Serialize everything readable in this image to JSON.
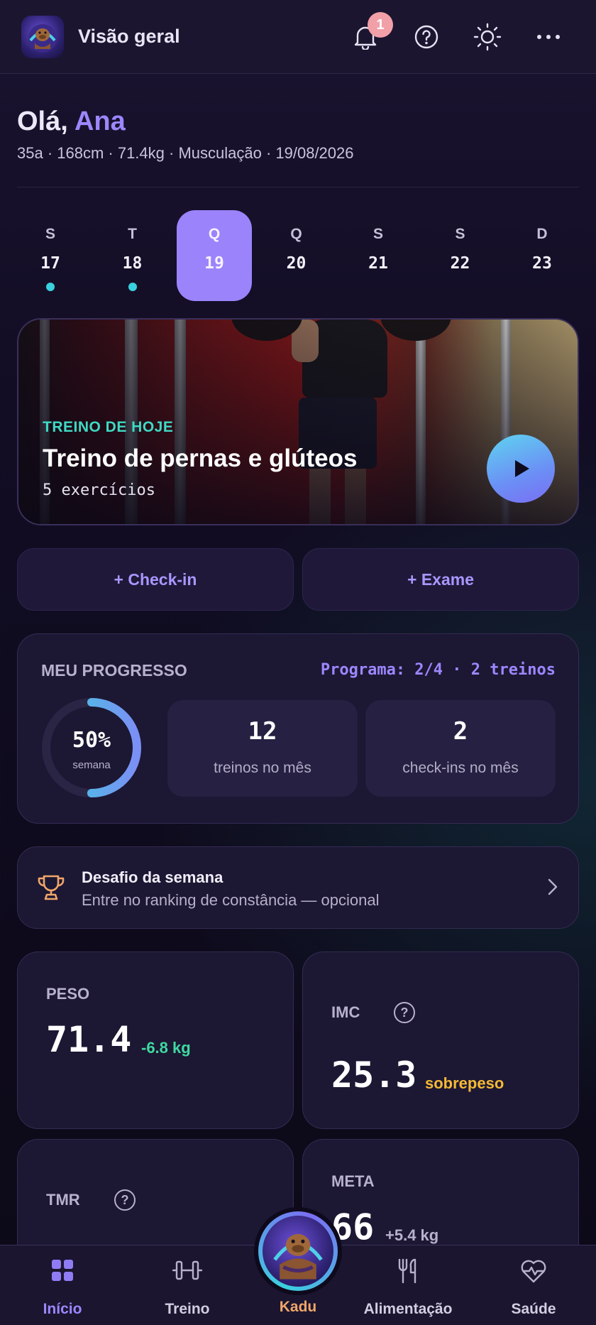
{
  "header": {
    "title": "Visão geral",
    "notification_count": "1",
    "icons": [
      "mascot-logo",
      "bell-icon",
      "help-icon",
      "theme-sun-icon",
      "more-icon"
    ]
  },
  "greeting": {
    "hello": "Olá,",
    "name": "Ana",
    "meta": "35a · 168cm · 71.4kg · Musculação · 19/08/2026"
  },
  "week": [
    {
      "letter": "S",
      "num": "17",
      "dot": true,
      "active": false
    },
    {
      "letter": "T",
      "num": "18",
      "dot": true,
      "active": false
    },
    {
      "letter": "Q",
      "num": "19",
      "dot": false,
      "active": true
    },
    {
      "letter": "Q",
      "num": "20",
      "dot": false,
      "active": false
    },
    {
      "letter": "S",
      "num": "21",
      "dot": false,
      "active": false
    },
    {
      "letter": "S",
      "num": "22",
      "dot": false,
      "active": false
    },
    {
      "letter": "D",
      "num": "23",
      "dot": false,
      "active": false
    }
  ],
  "today": {
    "tag": "TREINO DE HOJE",
    "title": "Treino de pernas e glúteos",
    "subtitle": "5 exercícios"
  },
  "quick_actions": {
    "checkin": "+ Check-in",
    "exam": "+ Exame"
  },
  "progress": {
    "label": "MEU PROGRESSO",
    "program": "Programa: 2/4 · 2 treinos",
    "ring_value": 0.5,
    "ring_text": "50%",
    "ring_caption": "semana",
    "stats": [
      {
        "num": "12",
        "caption": "treinos no mês"
      },
      {
        "num": "2",
        "caption": "check-ins no mês"
      }
    ]
  },
  "challenge": {
    "title": "Desafio da semana",
    "subtitle": "Entre no ranking de constância — opcional"
  },
  "metrics": {
    "weight": {
      "label": "PESO",
      "value": "71.4",
      "delta": "-6.8 kg"
    },
    "bmi": {
      "label": "IMC",
      "value": "25.3",
      "status": "sobrepeso"
    },
    "tmr": {
      "label": "TMR"
    },
    "goal": {
      "label": "META",
      "value": "66",
      "delta": "+5.4 kg"
    }
  },
  "nav": {
    "home": "Início",
    "workout": "Treino",
    "kadu": "Kadu",
    "food": "Alimentação",
    "health": "Saúde"
  },
  "colors": {
    "accent": "#9d87ff",
    "teal": "#3ad1de",
    "positive": "#3fd9a0",
    "warning": "#f5b935",
    "kadu": "#f0a66a"
  }
}
